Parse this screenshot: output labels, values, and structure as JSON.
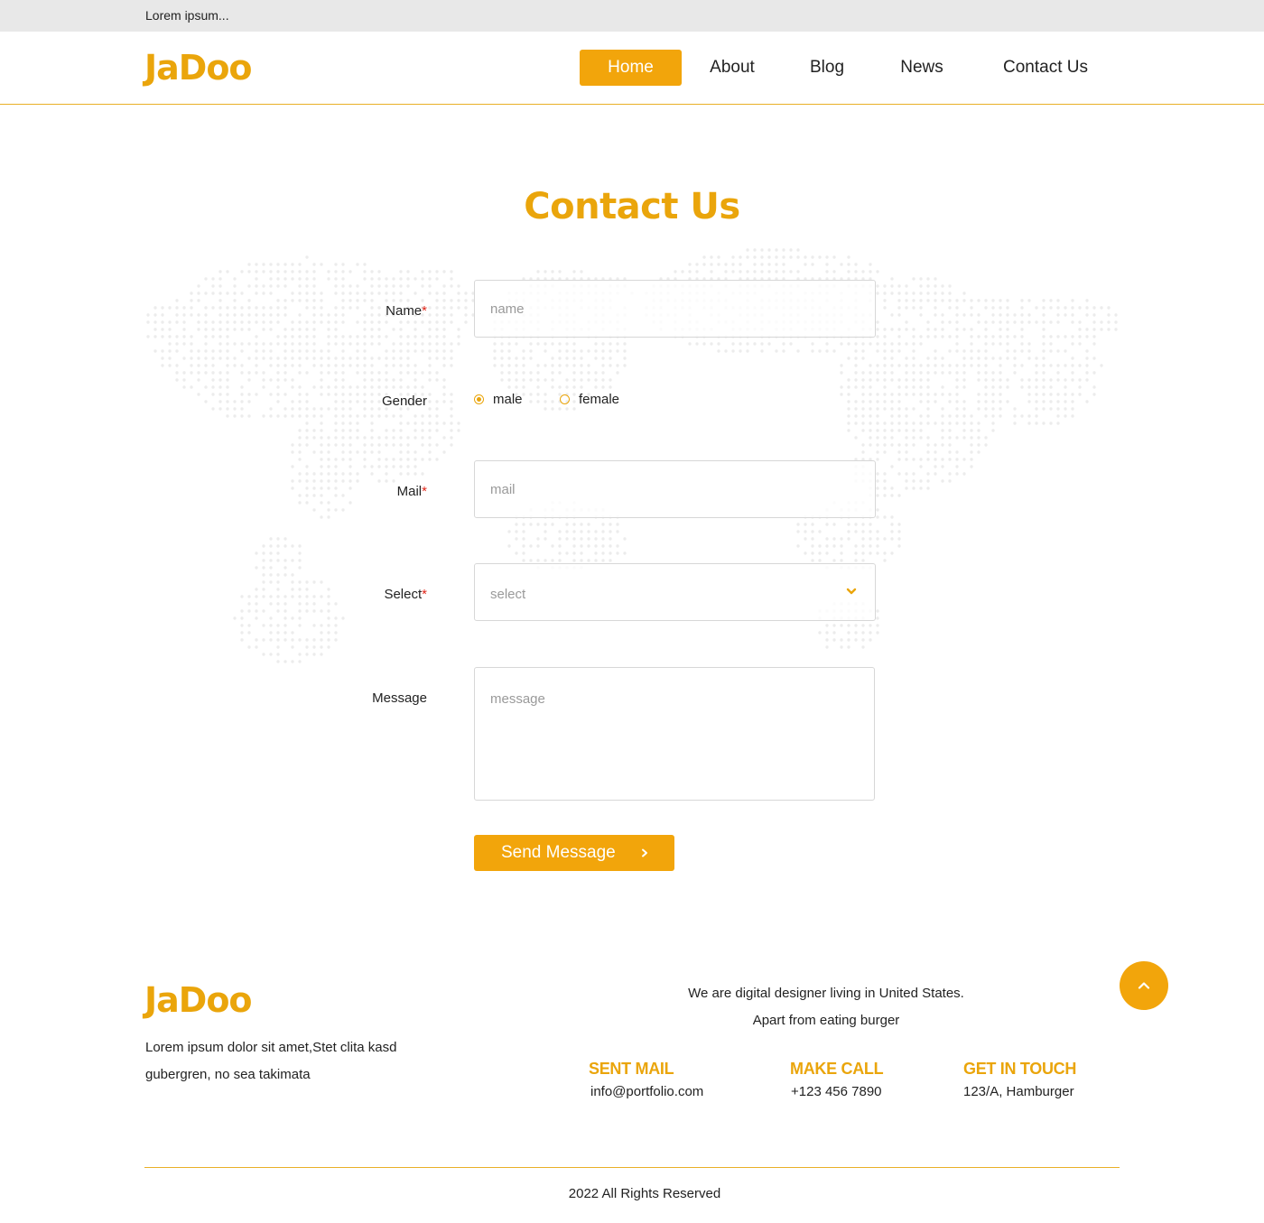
{
  "topbar": {
    "text": "Lorem ipsum..."
  },
  "brand": {
    "logo": "JaDoo",
    "accent_color": "#f2a50b"
  },
  "nav": {
    "items": [
      {
        "label": "Home",
        "active": true
      },
      {
        "label": "About",
        "active": false
      },
      {
        "label": "Blog",
        "active": false
      },
      {
        "label": "News",
        "active": false
      },
      {
        "label": "Contact Us",
        "active": false
      }
    ]
  },
  "page": {
    "title": "Contact Us"
  },
  "form": {
    "required_mark": "*",
    "name": {
      "label": "Name",
      "placeholder": "name",
      "value": ""
    },
    "gender": {
      "label": "Gender",
      "options": [
        {
          "label": "male",
          "checked": true
        },
        {
          "label": "female",
          "checked": false
        }
      ]
    },
    "mail": {
      "label": "Mail",
      "placeholder": "mail",
      "value": ""
    },
    "select": {
      "label": "Select",
      "value": "select",
      "icon": "chevron-down-icon"
    },
    "message": {
      "label": "Message",
      "placeholder": "message",
      "value": ""
    },
    "submit": {
      "label": "Send Message",
      "icon": "chevron-right-icon"
    }
  },
  "footer": {
    "logo": "JaDoo",
    "description": "Lorem ipsum dolor sit amet,Stet clita kasd gubergren, no sea takimata",
    "tagline_line1": "We are digital designer living in United States.",
    "tagline_line2": "Apart from eating burger",
    "scroll_top_icon": "chevron-up-icon",
    "contacts": [
      {
        "heading": "SENT MAIL",
        "value": "info@portfolio.com"
      },
      {
        "heading": "MAKE CALL",
        "value": "+123 456 7890"
      },
      {
        "heading": "GET IN TOUCH",
        "value": "123/A, Hamburger"
      }
    ],
    "copyright": "2022 All Rights Reserved"
  }
}
